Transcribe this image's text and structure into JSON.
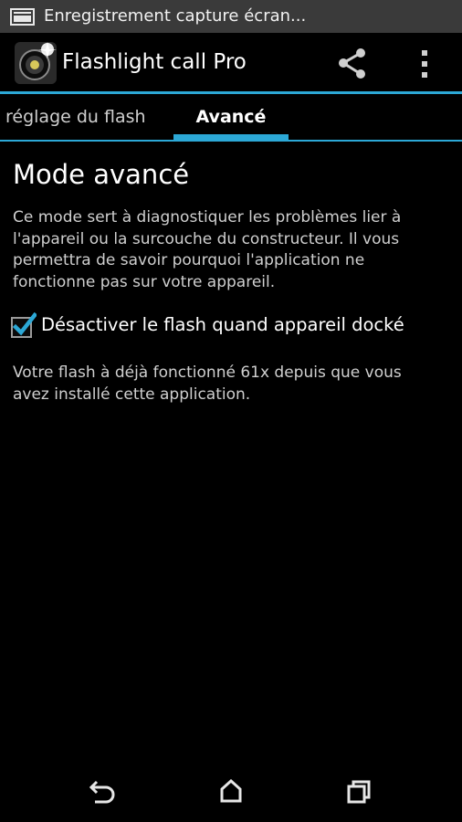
{
  "status_bar": {
    "notification_text": "Enregistrement capture écran...",
    "icon": "screen-recording-icon"
  },
  "action_bar": {
    "app_icon": "flashlight-app-icon",
    "title": "Flashlight call Pro",
    "share_icon": "share-icon",
    "overflow_icon": "overflow-menu-icon"
  },
  "tabs": [
    {
      "label": "réglage du flash",
      "selected": false
    },
    {
      "label": "Avancé",
      "selected": true
    }
  ],
  "content": {
    "title": "Mode avancé",
    "description": "Ce mode sert à diagnostiquer les problèmes lier à l'appareil ou la surcouche du constructeur. Il vous permettra de savoir pourquoi l'application ne fonctionne pas sur votre appareil.",
    "checkbox_label": "Désactiver le flash quand appareil docké",
    "checkbox_checked": true,
    "usage_note": "Votre flash à déjà fonctionné 61x depuis que vous avez installé cette application."
  },
  "nav_bar": {
    "back_icon": "back-icon",
    "home_icon": "home-icon",
    "recent_icon": "recent-apps-icon"
  },
  "colors": {
    "accent": "#2ca8d6",
    "status_bar": "#3a3a3a",
    "background": "#000000"
  }
}
